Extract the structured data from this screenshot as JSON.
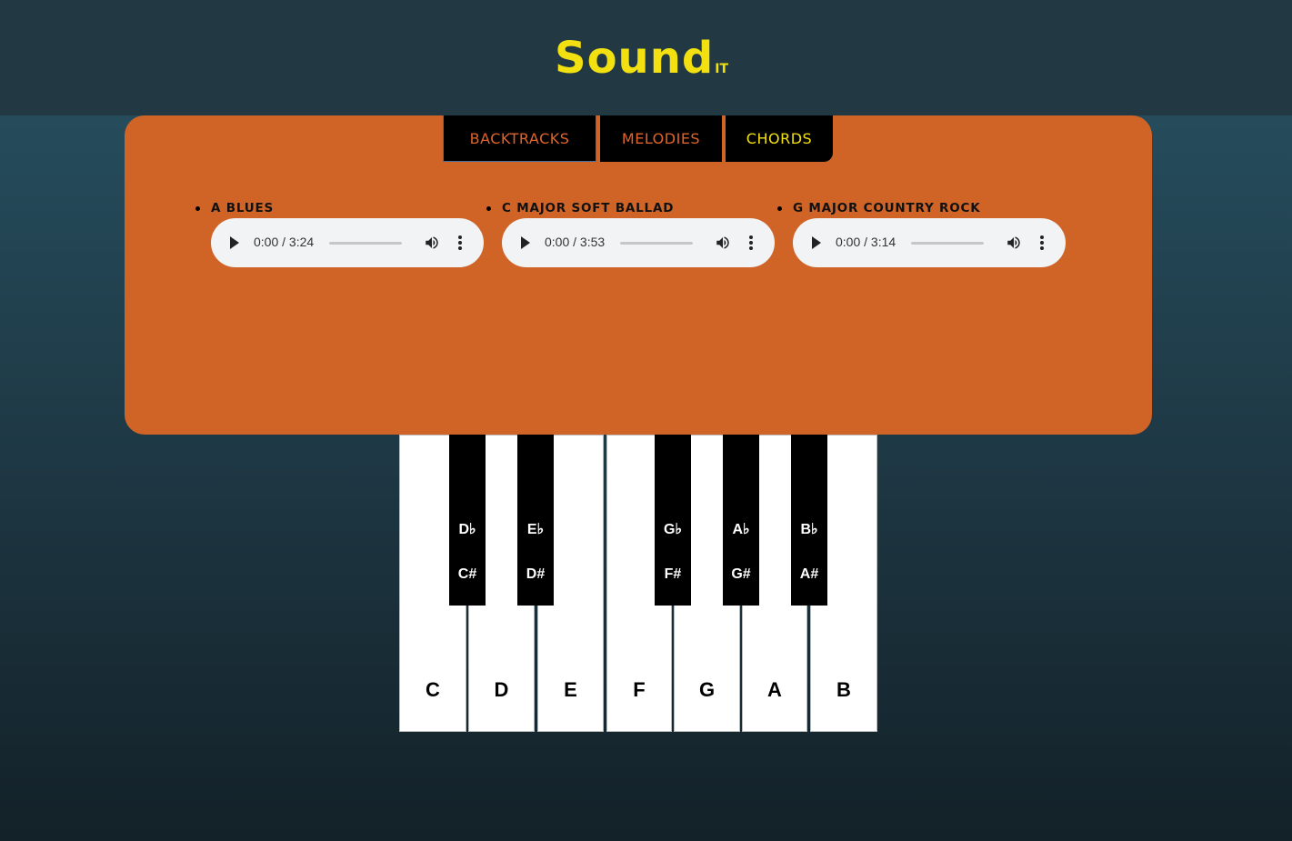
{
  "logo": {
    "main": "Sound",
    "sub": "IT"
  },
  "tabs": [
    {
      "label": "BACKTRACKS"
    },
    {
      "label": "MELODIES"
    },
    {
      "label": "CHORDS"
    }
  ],
  "tracks": [
    {
      "title": "A BLUES",
      "time": "0:00 / 3:24"
    },
    {
      "title": "C MAJOR SOFT BALLAD",
      "time": "0:00 / 3:53"
    },
    {
      "title": "G MAJOR COUNTRY ROCK",
      "time": "0:00 / 3:14"
    }
  ],
  "piano": {
    "white_keys": [
      "C",
      "D",
      "E",
      "F",
      "G",
      "A",
      "B"
    ],
    "black_keys": [
      {
        "flat": "D♭",
        "sharp": "C#"
      },
      {
        "flat": "E♭",
        "sharp": "D#"
      },
      {
        "flat": "G♭",
        "sharp": "F#"
      },
      {
        "flat": "A♭",
        "sharp": "G#"
      },
      {
        "flat": "B♭",
        "sharp": "A#"
      }
    ]
  },
  "colors": {
    "accent_yellow": "#f2e011",
    "panel_orange": "#d06427",
    "tab_orange": "#e0642a"
  },
  "icons": {
    "play": "play-icon",
    "volume": "volume-icon",
    "menu": "more-vert-icon"
  }
}
